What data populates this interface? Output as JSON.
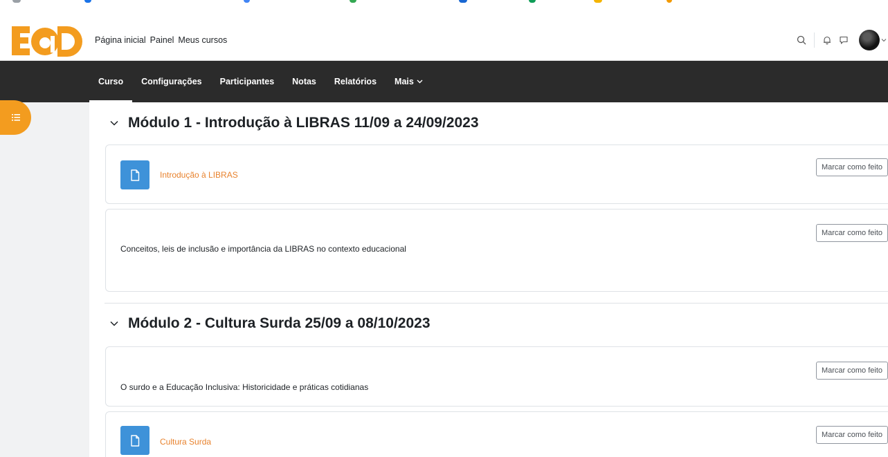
{
  "brand": {
    "logo_name": "EaD logo",
    "accent": "#f39c1f",
    "resource_blue": "#3e92d9",
    "link_orange": "#e8822d"
  },
  "primary_nav": {
    "items": [
      "Página inicial",
      "Painel",
      "Meus cursos"
    ]
  },
  "secondary_nav": {
    "items": [
      {
        "label": "Curso",
        "active": true
      },
      {
        "label": "Configurações"
      },
      {
        "label": "Participantes"
      },
      {
        "label": "Notas"
      },
      {
        "label": "Relatórios"
      },
      {
        "label": "Mais"
      }
    ]
  },
  "sections": [
    {
      "title": "Módulo 1 - Introdução à LIBRAS 11/09 a 24/09/2023",
      "activities": [
        {
          "type": "resource",
          "name": "Introdução à LIBRAS",
          "button": "Marcar como feito"
        },
        {
          "type": "label",
          "text": "Conceitos, leis de inclusão e importância da LIBRAS no contexto educacional",
          "button": "Marcar como feito"
        }
      ]
    },
    {
      "title": "Módulo 2 - Cultura Surda 25/09 a 08/10/2023",
      "activities": [
        {
          "type": "label",
          "text": "O surdo e a Educação Inclusiva: Historicidade e práticas cotidianas",
          "button": "Marcar como feito"
        },
        {
          "type": "resource",
          "name": "Cultura Surda",
          "button": "Marcar como feito"
        }
      ]
    }
  ],
  "icons": {
    "search": "search-icon",
    "notifications": "bell-icon",
    "messages": "chat-icon",
    "drawer": "course-index-icon",
    "section_toggle": "chevron-down-icon",
    "resource": "file-icon"
  }
}
